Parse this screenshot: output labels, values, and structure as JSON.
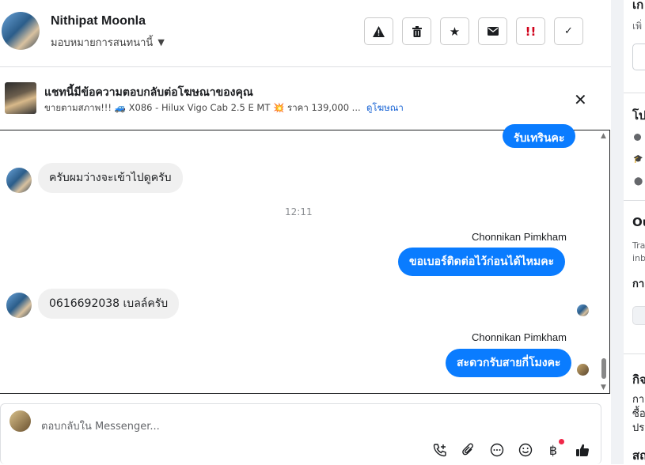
{
  "header": {
    "name": "Nithipat Moonla",
    "assign": "มอบหมายการสนทนานี้",
    "toolbar": [
      {
        "label": "⚠",
        "name": "report-icon"
      },
      {
        "label": "🗑",
        "name": "trash-icon"
      },
      {
        "label": "★",
        "name": "star-icon"
      },
      {
        "label": "✉",
        "name": "mail-icon"
      },
      {
        "label": "!!",
        "name": "important-icon"
      },
      {
        "label": "✓",
        "name": "check-icon"
      }
    ]
  },
  "ad": {
    "title": "แชทนี้มีข้อความตอบกลับต่อโฆษณาของคุณ",
    "subtitle": "ขายตามสภาพ!!! 🚙 X086 - Hilux Vigo Cab 2.5 E MT 💥 ราคา 139,000 ...",
    "link": "ดูโฆษณา"
  },
  "messages": {
    "m0": "รับเทรินคะ",
    "m1": "ครับผมว่างจะเข้าไปดูครับ",
    "time": "12:11",
    "sender1": "Chonnikan Pimkham",
    "m2": "ขอเบอร์ติดต่อไว้ก่อนได้ไหมคะ",
    "m3": "0616692038 เบลล์ครับ",
    "sender2": "Chonnikan Pimkham",
    "m4": "สะดวกรับสายกี่โมงคะ"
  },
  "composer": {
    "placeholder": "ตอบกลับใน Messenger..."
  },
  "right_panel": {
    "t1": "เก",
    "t2": "เพิ่",
    "t3": "โป",
    "t4": "Ou",
    "t5": "Tra",
    "t6": "inb",
    "t7": "กา",
    "t8": "กิจ",
    "t9": "กา",
    "t10": "ซื้อ",
    "t11": "ประ",
    "t12": "สถ"
  }
}
